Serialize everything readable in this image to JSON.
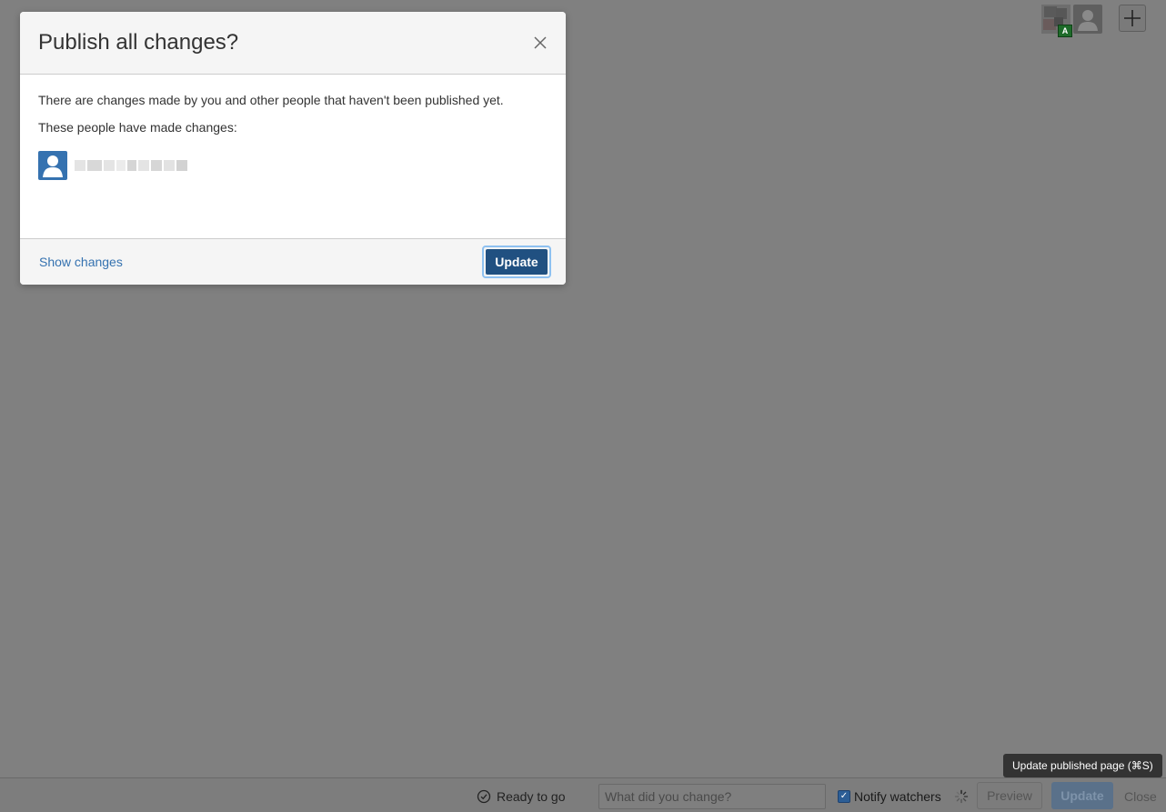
{
  "top_bar": {
    "collaborator_badge": "A",
    "icons": [
      "user-avatar",
      "default-avatar",
      "plus-icon"
    ]
  },
  "dialog": {
    "title": "Publish all changes?",
    "message": "There are changes made by you and other people that haven't been published yet.",
    "people_label": "These people have made changes:",
    "show_changes_label": "Show changes",
    "update_label": "Update",
    "colors": {
      "primary": "#205081",
      "link": "#3572b0",
      "avatar": "#3572b0"
    }
  },
  "bottom_bar": {
    "status": "Ready to go",
    "change_placeholder": "What did you change?",
    "notify_label": "Notify watchers",
    "notify_checked": true,
    "preview_label": "Preview",
    "update_label": "Update",
    "close_label": "Close",
    "tooltip": "Update published page (⌘S)"
  }
}
